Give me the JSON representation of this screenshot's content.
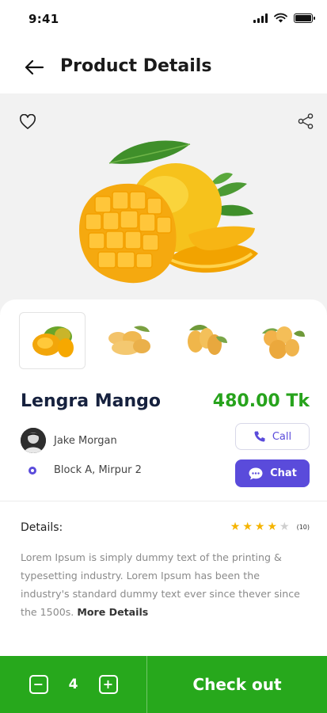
{
  "status_bar": {
    "time": "9:41",
    "icons": [
      "signal-icon",
      "wifi-icon",
      "battery-icon"
    ]
  },
  "header": {
    "back_icon": "arrow-left-icon",
    "title": "Product Details"
  },
  "hero": {
    "favorite_icon": "heart-outline-icon",
    "share_icon": "share-icon",
    "image": "mango-image"
  },
  "thumbnails": [
    {
      "image": "mango-thumbnail-1",
      "selected": true
    },
    {
      "image": "mango-thumbnail-2",
      "selected": false
    },
    {
      "image": "mango-thumbnail-3",
      "selected": false
    },
    {
      "image": "mango-thumbnail-4",
      "selected": false
    }
  ],
  "product": {
    "name": "Lengra Mango",
    "price": "480.00 Tk"
  },
  "seller": {
    "name": "Jake Morgan",
    "location": "Block A, Mirpur 2"
  },
  "actions": {
    "call_label": "Call",
    "call_icon": "phone-icon",
    "chat_label": "Chat",
    "chat_icon": "chat-bubble-icon"
  },
  "details": {
    "title": "Details:",
    "rating": 4,
    "rating_max": 5,
    "rating_count": "(10)",
    "description": "Lorem Ipsum is simply dummy text of the printing & typesetting industry. Lorem Ipsum has been the industry's standard dummy text ever since thever since the 1500s.",
    "more_label": "More Details"
  },
  "cart": {
    "minus_icon": "minus-icon",
    "plus_icon": "plus-icon",
    "quantity": "4",
    "checkout_label": "Check out"
  },
  "colors": {
    "primary_green": "#27a81c",
    "price_green": "#27a31c",
    "accent_purple": "#5a4bdb",
    "star": "#f5b400"
  }
}
